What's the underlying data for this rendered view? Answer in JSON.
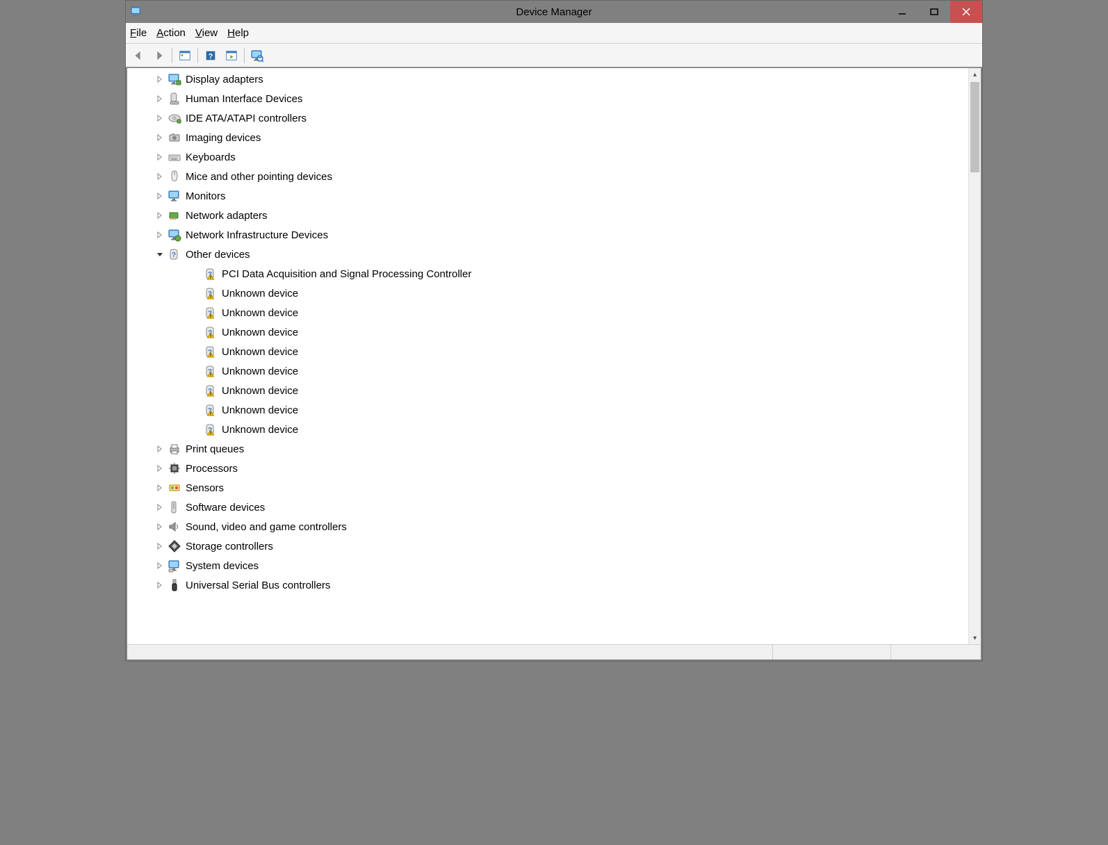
{
  "window": {
    "title": "Device Manager"
  },
  "menubar": {
    "file": "File",
    "action": "Action",
    "view": "View",
    "help": "Help"
  },
  "tree": {
    "categories": [
      {
        "label": "Display adapters",
        "icon": "display",
        "expanded": false
      },
      {
        "label": "Human Interface Devices",
        "icon": "hid",
        "expanded": false
      },
      {
        "label": "IDE ATA/ATAPI controllers",
        "icon": "ide",
        "expanded": false
      },
      {
        "label": "Imaging devices",
        "icon": "camera",
        "expanded": false
      },
      {
        "label": "Keyboards",
        "icon": "keyboard",
        "expanded": false
      },
      {
        "label": "Mice and other pointing devices",
        "icon": "mouse",
        "expanded": false
      },
      {
        "label": "Monitors",
        "icon": "monitor",
        "expanded": false
      },
      {
        "label": "Network adapters",
        "icon": "netadapter",
        "expanded": false
      },
      {
        "label": "Network Infrastructure Devices",
        "icon": "netinfra",
        "expanded": false
      },
      {
        "label": "Other devices",
        "icon": "other",
        "expanded": true,
        "children": [
          {
            "label": "PCI Data Acquisition and Signal Processing Controller",
            "icon": "unknown"
          },
          {
            "label": "Unknown device",
            "icon": "unknown"
          },
          {
            "label": "Unknown device",
            "icon": "unknown"
          },
          {
            "label": "Unknown device",
            "icon": "unknown"
          },
          {
            "label": "Unknown device",
            "icon": "unknown"
          },
          {
            "label": "Unknown device",
            "icon": "unknown"
          },
          {
            "label": "Unknown device",
            "icon": "unknown"
          },
          {
            "label": "Unknown device",
            "icon": "unknown"
          },
          {
            "label": "Unknown device",
            "icon": "unknown"
          }
        ]
      },
      {
        "label": "Print queues",
        "icon": "print",
        "expanded": false
      },
      {
        "label": "Processors",
        "icon": "cpu",
        "expanded": false
      },
      {
        "label": "Sensors",
        "icon": "sensor",
        "expanded": false
      },
      {
        "label": "Software devices",
        "icon": "software",
        "expanded": false
      },
      {
        "label": "Sound, video and game controllers",
        "icon": "sound",
        "expanded": false
      },
      {
        "label": "Storage controllers",
        "icon": "storage",
        "expanded": false
      },
      {
        "label": "System devices",
        "icon": "system",
        "expanded": false
      },
      {
        "label": "Universal Serial Bus controllers",
        "icon": "usb",
        "expanded": false
      }
    ]
  }
}
